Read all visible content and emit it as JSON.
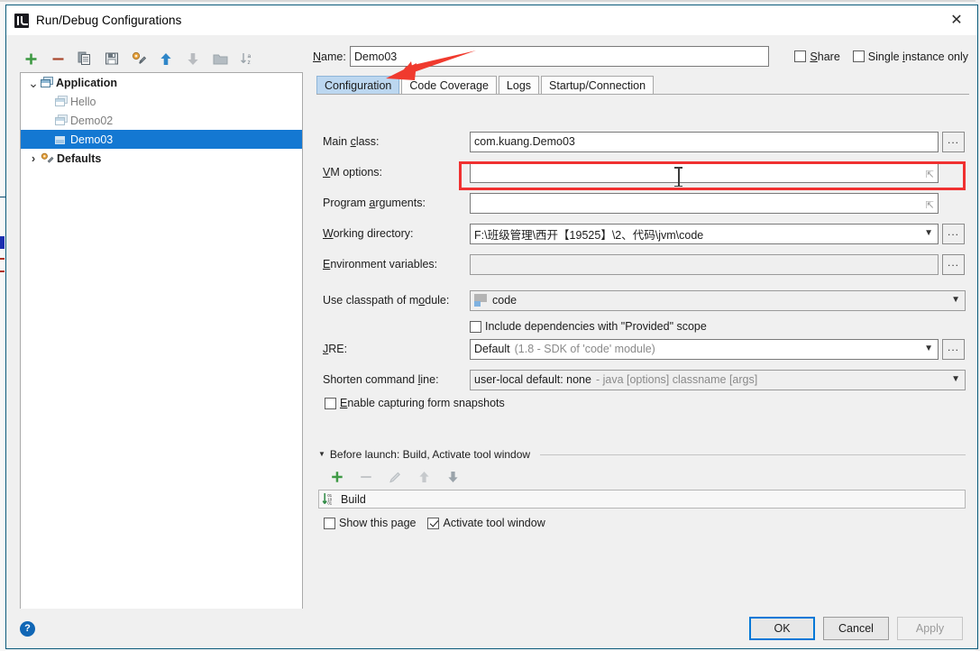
{
  "window": {
    "title": "Run/Debug Configurations",
    "logo_icon": "intellij-idea-logo-icon",
    "close_icon": "close-icon"
  },
  "left_panel": {
    "toolbar": [
      {
        "name": "add-configuration-button",
        "icon": "plus-icon",
        "glyph": "+"
      },
      {
        "name": "remove-configuration-button",
        "icon": "minus-icon",
        "glyph": "−"
      },
      {
        "name": "copy-configuration-button",
        "icon": "copy-icon",
        "glyph": "copy"
      },
      {
        "name": "save-configuration-button",
        "icon": "save-icon",
        "glyph": "save"
      },
      {
        "name": "edit-defaults-button",
        "icon": "wrench-icon",
        "glyph": "wrench"
      },
      {
        "name": "move-up-button",
        "icon": "arrow-up-icon",
        "glyph": "↑"
      },
      {
        "name": "move-down-button",
        "icon": "arrow-down-icon",
        "glyph": "↓"
      },
      {
        "name": "move-into-folder-button",
        "icon": "folder-icon",
        "glyph": "folder"
      },
      {
        "name": "sort-configurations-button",
        "icon": "sort-az-icon",
        "glyph": "sort"
      }
    ],
    "tree": [
      {
        "label": "Application",
        "level": 0,
        "expander": "⌄",
        "icon": "application-icon",
        "bold": true,
        "selected": false,
        "dim": false
      },
      {
        "label": "Hello",
        "level": 1,
        "expander": "",
        "icon": "application-icon",
        "bold": false,
        "selected": false,
        "dim": true
      },
      {
        "label": "Demo02",
        "level": 1,
        "expander": "",
        "icon": "application-icon",
        "bold": false,
        "selected": false,
        "dim": true
      },
      {
        "label": "Demo03",
        "level": 1,
        "expander": "",
        "icon": "application-icon",
        "bold": false,
        "selected": true,
        "dim": false
      },
      {
        "label": "Defaults",
        "level": 0,
        "expander": "›",
        "icon": "wrench-icon",
        "bold": true,
        "selected": false,
        "dim": false
      }
    ]
  },
  "name_row": {
    "label": "Name:",
    "label_mnemonic": "N",
    "value": "Demo03",
    "placeholder": "",
    "share": {
      "label": "Share",
      "mnemonic": "S",
      "checked": false
    },
    "single_instance": {
      "label": "Single instance only",
      "mnemonic": "i",
      "checked": false
    }
  },
  "tabs": [
    {
      "label": "Configuration",
      "active": true
    },
    {
      "label": "Code Coverage",
      "active": false
    },
    {
      "label": "Logs",
      "active": false
    },
    {
      "label": "Startup/Connection",
      "active": false
    }
  ],
  "form": {
    "main_class": {
      "label": "Main class:",
      "value": "com.kuang.Demo03",
      "browse_label": "...",
      "browse_icon": "ellipsis-icon"
    },
    "vm_options": {
      "label": "VM options:",
      "value": "",
      "expand_icon": "expand-editor-icon",
      "highlighted": true,
      "highlight_color": "#f03030"
    },
    "program_arguments": {
      "label": "Program arguments:",
      "value": "",
      "expand_icon": "expand-editor-icon"
    },
    "working_directory": {
      "label": "Working directory:",
      "value": "F:\\班级管理\\西开【19525】\\2、代码\\jvm\\code",
      "dropdown_icon": "chevron-down-icon",
      "browse_label": "...",
      "browse_icon": "ellipsis-icon"
    },
    "environment_variables": {
      "label": "Environment variables:",
      "value": "",
      "browse_label": "...",
      "browse_icon": "ellipsis-icon"
    },
    "use_classpath_of_module": {
      "label": "Use classpath of module:",
      "value": "code",
      "module_icon": "module-icon",
      "dropdown_icon": "chevron-down-icon"
    },
    "include_provided": {
      "label": "Include dependencies with \"Provided\" scope",
      "checked": false
    },
    "jre": {
      "label": "JRE:",
      "value": "Default",
      "value_hint": "(1.8 - SDK of 'code' module)",
      "dropdown_icon": "chevron-down-icon",
      "browse_label": "...",
      "browse_icon": "ellipsis-icon"
    },
    "shorten_command_line": {
      "label": "Shorten command line:",
      "value": "user-local default: none",
      "value_hint": "- java [options] classname [args]",
      "dropdown_icon": "chevron-down-icon"
    },
    "enable_capturing": {
      "label": "Enable capturing form snapshots",
      "checked": false
    }
  },
  "before_launch": {
    "header": "Before launch: Build, Activate tool window",
    "collapse_icon": "triangle-down-icon",
    "toolbar": [
      {
        "name": "add-task-button",
        "icon": "plus-icon",
        "glyph": "+",
        "enabled": true
      },
      {
        "name": "remove-task-button",
        "icon": "minus-icon",
        "glyph": "−",
        "enabled": false
      },
      {
        "name": "edit-task-button",
        "icon": "pencil-icon",
        "glyph": "pencil",
        "enabled": false
      },
      {
        "name": "task-move-up-button",
        "icon": "arrow-up-icon",
        "glyph": "↑",
        "enabled": false
      },
      {
        "name": "task-move-down-button",
        "icon": "arrow-down-icon",
        "glyph": "↓",
        "enabled": false
      }
    ],
    "tasks": [
      {
        "label": "Build",
        "icon": "build-icon"
      }
    ],
    "show_this_page": {
      "label": "Show this page",
      "checked": false
    },
    "activate_tool_window": {
      "label": "Activate tool window",
      "checked": true
    }
  },
  "footer": {
    "help_icon": "help-icon",
    "help_glyph": "?",
    "buttons": [
      {
        "label": "OK",
        "name": "ok-button",
        "state": "default"
      },
      {
        "label": "Cancel",
        "name": "cancel-button",
        "state": "normal"
      },
      {
        "label": "Apply",
        "name": "apply-button",
        "state": "disabled"
      }
    ]
  },
  "annotation": {
    "arrow_color": "#f03a2e",
    "arrow_icon": "red-pointer-arrow-icon"
  }
}
